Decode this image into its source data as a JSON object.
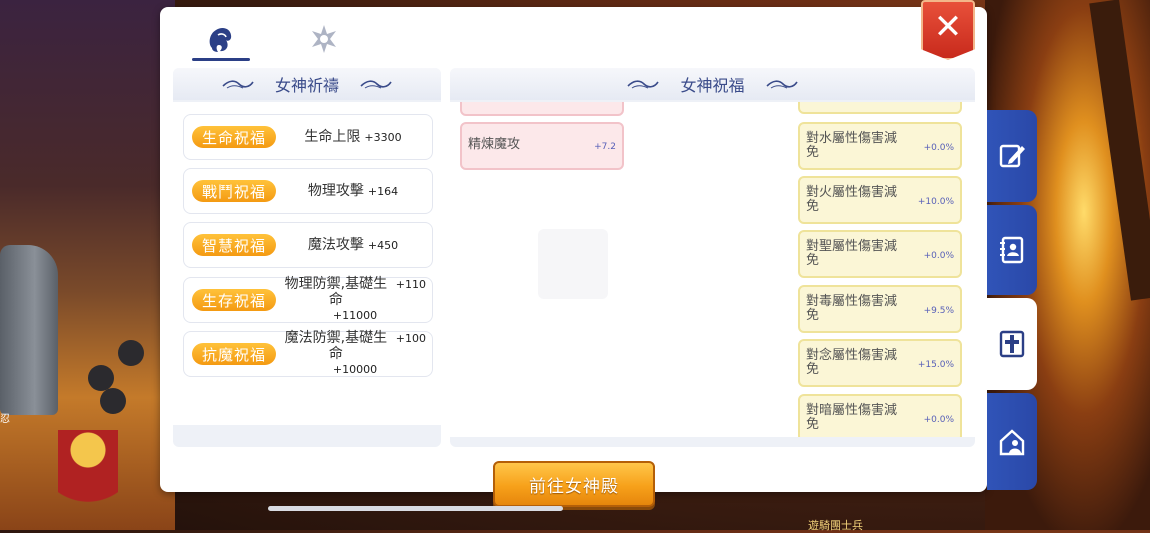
{
  "tabs": [
    {
      "name": "goddess-tab",
      "icon": "goddess-silhouette-icon",
      "active": true
    },
    {
      "name": "crystal-tab",
      "icon": "crystal-flower-icon",
      "active": false
    }
  ],
  "close": {
    "label": "✕"
  },
  "left_section": {
    "title": "女神祈禱",
    "rows": [
      {
        "pill": "生命祝福",
        "stat": "生命上限",
        "value": "+3300",
        "line2": ""
      },
      {
        "pill": "戰鬥祝福",
        "stat": "物理攻擊",
        "value": "+164",
        "line2": ""
      },
      {
        "pill": "智慧祝福",
        "stat": "魔法攻擊",
        "value": "+450",
        "line2": ""
      },
      {
        "pill": "生存祝福",
        "stat": "物理防禦,基礎生命",
        "value": "+110",
        "line2": "+11000"
      },
      {
        "pill": "抗魔祝福",
        "stat": "魔法防禦,基礎生命",
        "value": "+100",
        "line2": "+10000"
      }
    ]
  },
  "right_section": {
    "title": "女神祝福",
    "pink_cards": [
      {
        "name": "精煉魔攻",
        "value": "+7.2"
      }
    ],
    "yellow_cards": [
      {
        "name": "對水屬性傷害減免",
        "value": "+0.0%"
      },
      {
        "name": "對火屬性傷害減免",
        "value": "+10.0%"
      },
      {
        "name": "對聖屬性傷害減免",
        "value": "+0.0%"
      },
      {
        "name": "對毒屬性傷害減免",
        "value": "+9.5%"
      },
      {
        "name": "對念屬性傷害減免",
        "value": "+15.0%"
      },
      {
        "name": "對暗屬性傷害減免",
        "value": "+0.0%"
      }
    ]
  },
  "go_button": {
    "label": "前往女神殿"
  },
  "side_tabs": [
    {
      "name": "edit-tab",
      "icon": "edit-pencil-icon",
      "active": false
    },
    {
      "name": "contacts-tab",
      "icon": "contact-book-icon",
      "active": false
    },
    {
      "name": "goddess-cross-tab",
      "icon": "cross-icon",
      "active": true
    },
    {
      "name": "guild-home-tab",
      "icon": "home-person-icon",
      "active": false
    }
  ],
  "background": {
    "left_tag": "忍",
    "bottom_text": "遊騎團士兵"
  },
  "colors": {
    "accent_blue": "#2b3f86",
    "pill_orange": "#f49a12",
    "close_red": "#d63a28",
    "side_tab_blue": "#3054b8"
  }
}
